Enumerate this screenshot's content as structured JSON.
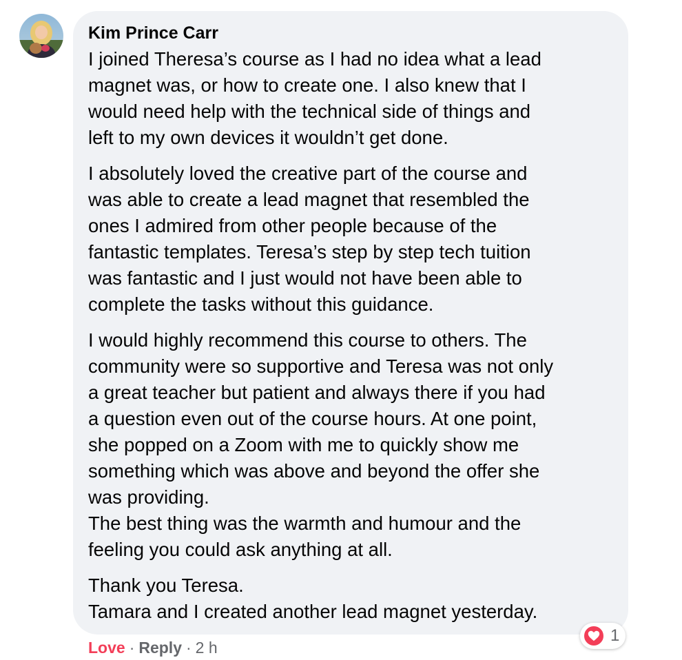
{
  "comment": {
    "author": "Kim Prince Carr",
    "paragraphs": [
      "I joined Theresa’s course as I had no idea what a lead\nmagnet was, or how to create one. I also knew that I\nwould need help with the technical side of things and\nleft to my own devices it wouldn’t get done.",
      "I absolutely loved the creative part of the course and\nwas able to create a lead magnet that resembled the\nones I admired from other people because of the\nfantastic templates. Teresa’s step by step tech tuition\nwas fantastic and I just would not have been able to\ncomplete the tasks without this guidance.",
      "I would highly recommend this course to others. The\ncommunity were so supportive and Teresa was not only\na great teacher but patient and always there if you had\na question even out of the course hours. At one point,\nshe popped on a Zoom with me to quickly show me\nsomething which was above and beyond the offer she\nwas providing.\nThe best thing was the warmth and humour and the\nfeeling you could ask anything at all.",
      "Thank you Teresa.\nTamara and I created another lead magnet yesterday."
    ]
  },
  "actions": {
    "love_label": "Love",
    "separator": "·",
    "reply_label": "Reply",
    "timestamp": "2 h"
  },
  "reaction": {
    "icon": "heart-icon",
    "count": "1"
  },
  "colors": {
    "bubble_bg": "#f0f2f5",
    "love_red": "#f33e58",
    "secondary_text": "#65676b"
  }
}
